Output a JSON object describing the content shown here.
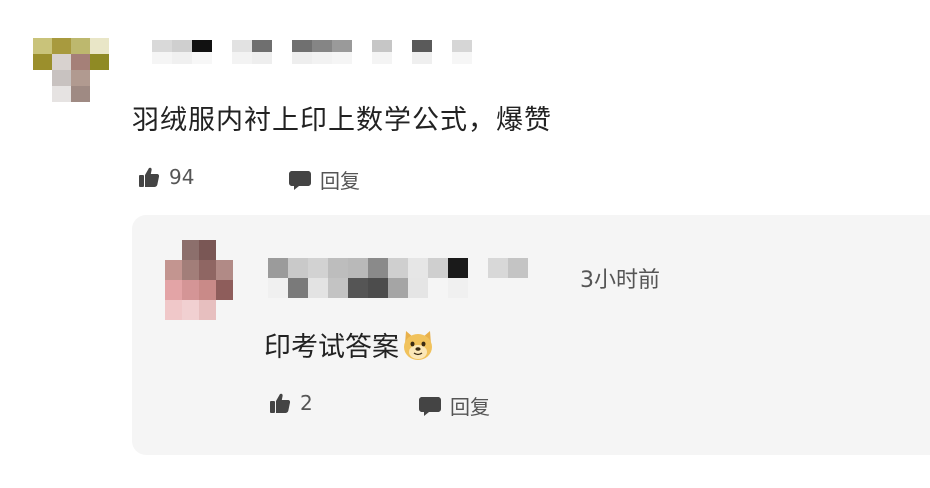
{
  "comment": {
    "text": "羽绒服内衬上印上数学公式，爆赞",
    "likes": "94",
    "reply_label": "回复"
  },
  "reply": {
    "time": "3小时前",
    "text": "印考试答案",
    "emoji": "doge-emoji",
    "likes": "2",
    "reply_label": "回复"
  },
  "icons": {
    "like": "thumbs-up-icon",
    "reply": "speech-bubble-icon"
  },
  "colors": {
    "text": "#222222",
    "secondary": "#555555",
    "reply_bg": "#f5f5f5"
  }
}
